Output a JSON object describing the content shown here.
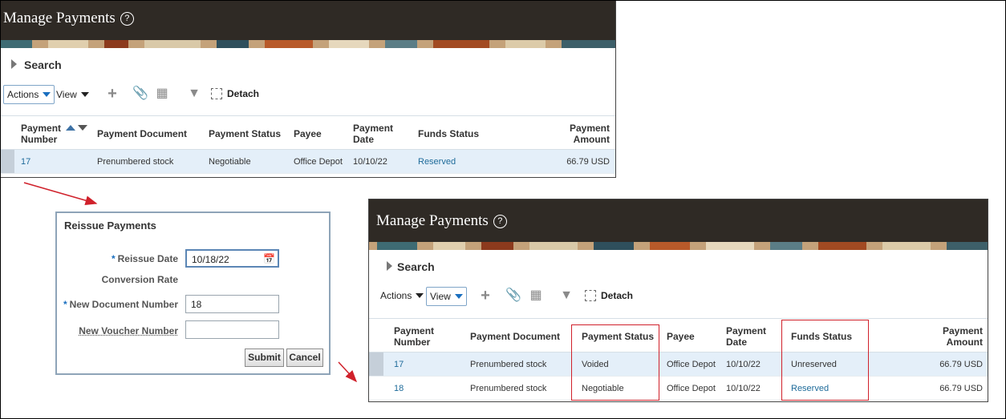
{
  "top_panel": {
    "title": "Manage Payments",
    "help_icon": "?",
    "search_label": "Search",
    "toolbar": {
      "actions": "Actions",
      "view": "View",
      "detach": "Detach"
    },
    "columns": [
      "Payment Number",
      "Payment Document",
      "Payment Status",
      "Payee",
      "Payment Date",
      "Funds Status",
      "Payment Amount"
    ],
    "rows": [
      {
        "number": "17",
        "document": "Prenumbered stock",
        "status": "Negotiable",
        "payee": "Office Depot",
        "date": "10/10/22",
        "funds": "Reserved",
        "amount": "66.79 USD"
      }
    ]
  },
  "dialog": {
    "title": "Reissue Payments",
    "reissue_date_label": "Reissue Date",
    "reissue_date_value": "10/18/22",
    "conversion_rate_label": "Conversion Rate",
    "new_doc_label": "New Document Number",
    "new_doc_value": "18",
    "new_voucher_label": "New Voucher Number",
    "new_voucher_value": "",
    "submit": "Submit",
    "cancel": "Cancel"
  },
  "bottom_panel": {
    "title": "Manage Payments",
    "help_icon": "?",
    "search_label": "Search",
    "toolbar": {
      "actions": "Actions",
      "view": "View",
      "detach": "Detach"
    },
    "columns": [
      "Payment Number",
      "Payment Document",
      "Payment Status",
      "Payee",
      "Payment Date",
      "Funds Status",
      "Payment Amount"
    ],
    "rows": [
      {
        "number": "17",
        "document": "Prenumbered stock",
        "status": "Voided",
        "payee": "Office Depot",
        "date": "10/10/22",
        "funds": "Unreserved",
        "amount": "66.79 USD"
      },
      {
        "number": "18",
        "document": "Prenumbered stock",
        "status": "Negotiable",
        "payee": "Office Depot",
        "date": "10/10/22",
        "funds": "Reserved",
        "amount": "66.79 USD"
      }
    ]
  },
  "colors": {
    "header": "#2f2a25",
    "link": "#1e6b9a",
    "annotation_red": "#d0212b",
    "selected_row": "#e4eff9"
  }
}
